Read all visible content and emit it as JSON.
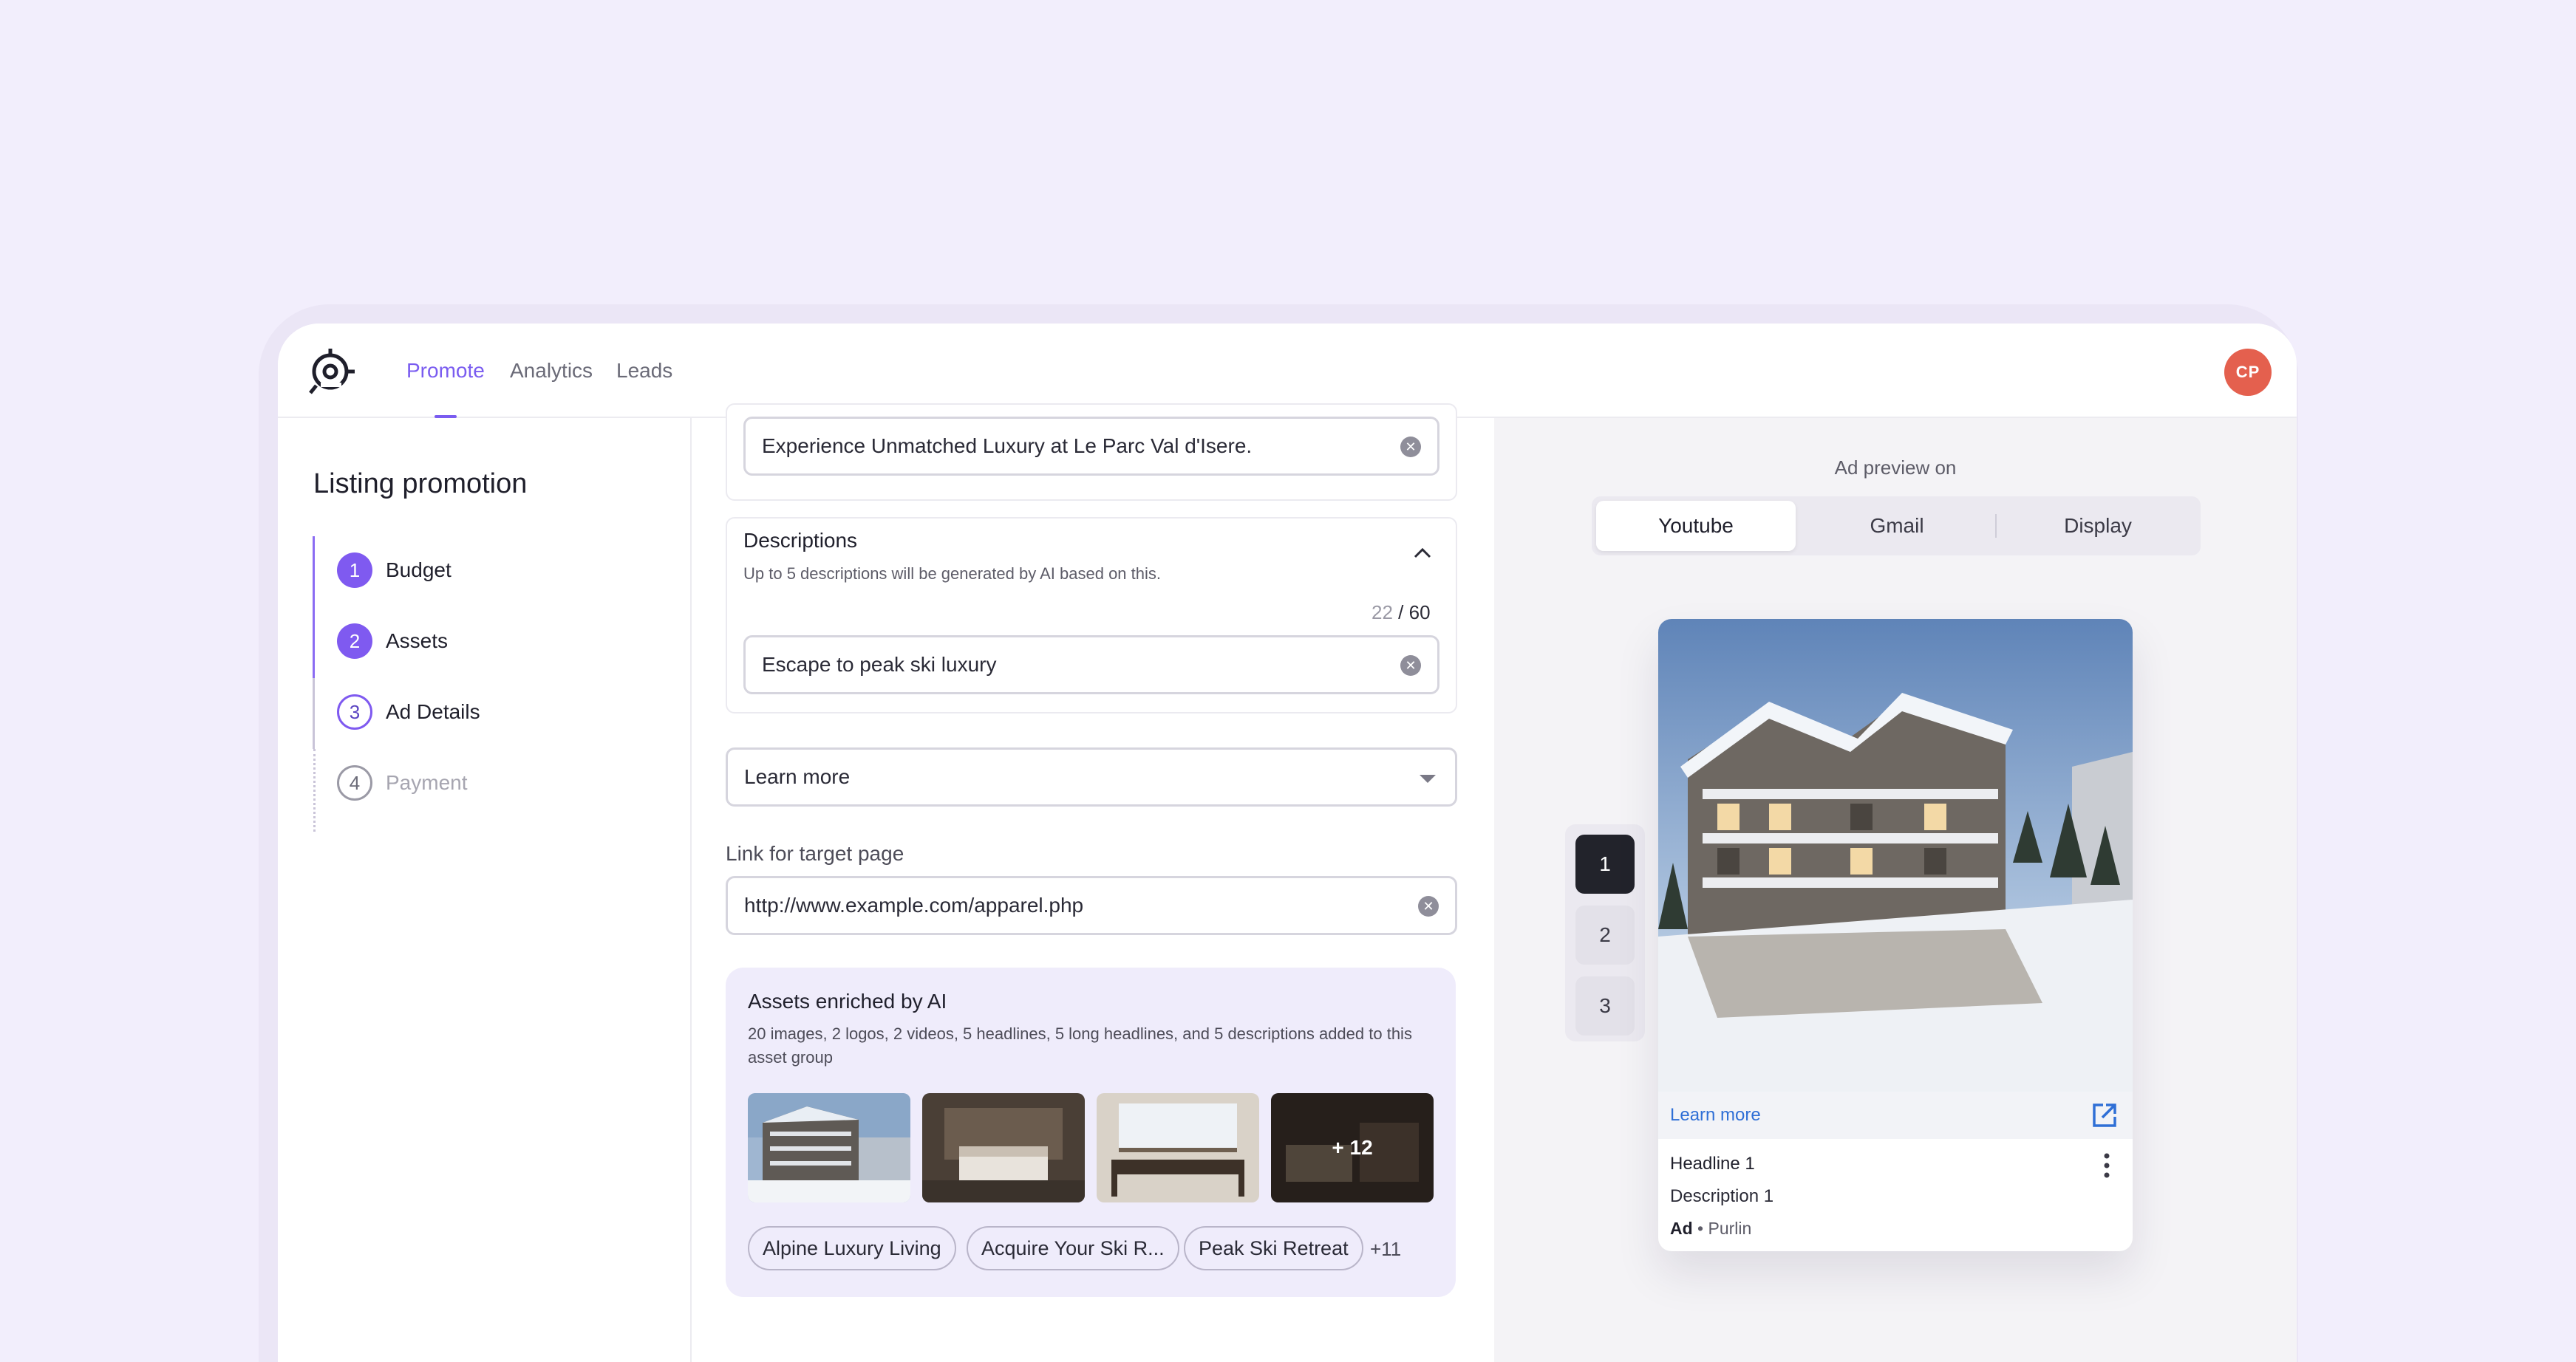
{
  "nav": {
    "items": [
      "Promote",
      "Analytics",
      "Leads"
    ],
    "active": "Promote",
    "avatar_initials": "CP"
  },
  "sidebar": {
    "title": "Listing promotion",
    "steps": [
      {
        "num": "1",
        "label": "Budget"
      },
      {
        "num": "2",
        "label": "Assets"
      },
      {
        "num": "3",
        "label": "Ad Details"
      },
      {
        "num": "4",
        "label": "Payment"
      }
    ]
  },
  "form": {
    "headline_value": "Experience Unmatched Luxury at Le Parc Val d'Isere.",
    "descriptions": {
      "title": "Descriptions",
      "subtitle": "Up to 5 descriptions will be generated by AI based on this.",
      "count": "22",
      "max": "/ 60",
      "value": "Escape to peak ski luxury"
    },
    "cta_select": "Learn more",
    "link": {
      "label": "Link for target page",
      "value": "http://www.example.com/apparel.php"
    },
    "ai": {
      "title": "Assets enriched by AI",
      "subtitle": "20 images, 2 logos, 2 videos, 5 headlines, 5 long headlines, and 5 descriptions added to this asset group",
      "more_images": "+ 12",
      "chips": [
        "Alpine Luxury Living",
        "Acquire Your Ski R...",
        "Peak Ski Retreat"
      ],
      "more_chips": "+11"
    }
  },
  "preview": {
    "heading": "Ad preview on",
    "tabs": [
      "Youtube",
      "Gmail",
      "Display"
    ],
    "active_tab": "Youtube",
    "pages": [
      "1",
      "2",
      "3"
    ],
    "active_page": "1",
    "ad": {
      "cta": "Learn more",
      "headline": "Headline 1",
      "description": "Description 1",
      "ad_label": "Ad",
      "sep": " • ",
      "advertiser": "Purlin"
    }
  }
}
